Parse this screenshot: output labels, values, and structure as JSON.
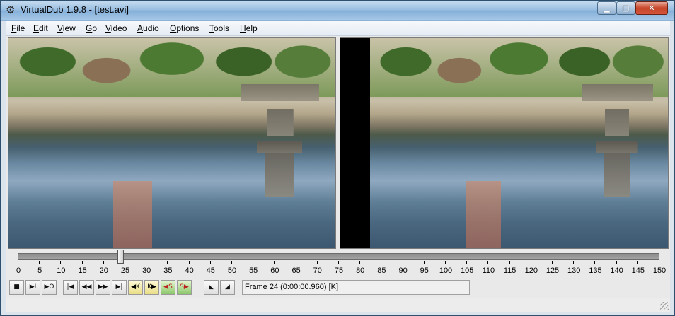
{
  "window": {
    "title": "VirtualDub 1.9.8 - [test.avi]"
  },
  "titlebar_buttons": {
    "minimize": "▁",
    "maximize": "▢",
    "close": "✕"
  },
  "menu": [
    "File",
    "Edit",
    "View",
    "Go",
    "Video",
    "Audio",
    "Options",
    "Tools",
    "Help"
  ],
  "timeline": {
    "min": 0,
    "max": 150,
    "current_frame": 24,
    "tick_labels": [
      "0",
      "5",
      "10",
      "15",
      "20",
      "25",
      "30",
      "35",
      "40",
      "45",
      "50",
      "55",
      "60",
      "65",
      "70",
      "75",
      "80",
      "85",
      "90",
      "95",
      "100",
      "105",
      "110",
      "115",
      "120",
      "125",
      "130",
      "135",
      "140",
      "145",
      "150"
    ]
  },
  "toolbar": {
    "buttons": [
      {
        "name": "stop-button",
        "icon": "stop-icon",
        "glyph": "■"
      },
      {
        "name": "play-input-button",
        "icon": "play-input-icon",
        "glyph": "▶I"
      },
      {
        "name": "play-output-button",
        "icon": "play-output-icon",
        "glyph": "▶O"
      },
      {
        "name": "go-to-start-button",
        "icon": "go-to-start-icon",
        "glyph": "|◀"
      },
      {
        "name": "previous-frame-button",
        "icon": "previous-frame-icon",
        "glyph": "◀◀"
      },
      {
        "name": "next-frame-button",
        "icon": "next-frame-icon",
        "glyph": "▶▶"
      },
      {
        "name": "go-to-end-button",
        "icon": "go-to-end-icon",
        "glyph": "▶|"
      },
      {
        "name": "previous-keyframe-button",
        "icon": "previous-keyframe-icon",
        "glyph": "◀K"
      },
      {
        "name": "next-keyframe-button",
        "icon": "next-keyframe-icon",
        "glyph": "K▶"
      },
      {
        "name": "scene-back-button",
        "icon": "scene-back-icon",
        "glyph": "◀S"
      },
      {
        "name": "scene-forward-button",
        "icon": "scene-forward-icon",
        "glyph": "S▶"
      },
      {
        "name": "mark-in-button",
        "icon": "mark-in-icon",
        "glyph": "◣"
      },
      {
        "name": "mark-out-button",
        "icon": "mark-out-icon",
        "glyph": "◢"
      }
    ],
    "frame_status": "Frame 24 (0:00:00.960) [K]"
  }
}
